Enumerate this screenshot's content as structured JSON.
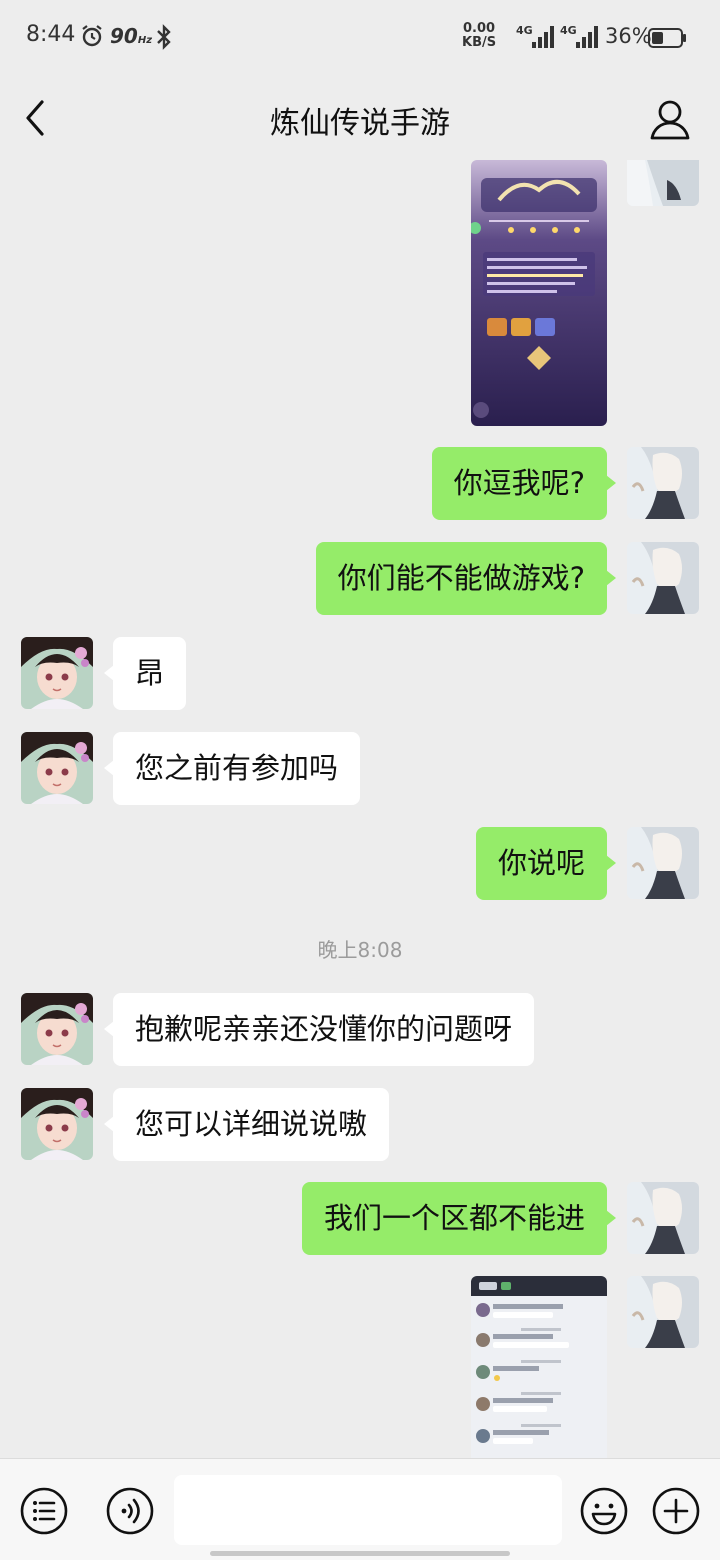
{
  "status_bar": {
    "time": "8:44",
    "refresh": "90",
    "refresh_unit": "Hz",
    "speed_value": "0.00",
    "speed_unit": "KB/S",
    "net1": "4G",
    "net2": "4G",
    "battery": "36%"
  },
  "header": {
    "title": "炼仙传说手游"
  },
  "messages": [
    {
      "from": "me",
      "type": "image"
    },
    {
      "from": "me",
      "type": "text",
      "text": "你逗我呢?"
    },
    {
      "from": "me",
      "type": "text",
      "text": "你们能不能做游戏?"
    },
    {
      "from": "them",
      "type": "text",
      "text": "昂"
    },
    {
      "from": "them",
      "type": "text",
      "text": "您之前有参加吗"
    },
    {
      "from": "me",
      "type": "text",
      "text": "你说呢"
    },
    {
      "from": "them",
      "type": "text",
      "text": "抱歉呢亲亲还没懂你的问题呀"
    },
    {
      "from": "them",
      "type": "text",
      "text": "您可以详细说说嗷"
    },
    {
      "from": "me",
      "type": "text",
      "text": "我们一个区都不能进"
    },
    {
      "from": "me",
      "type": "image"
    }
  ],
  "timestamp": "晚上8:08",
  "input": {
    "placeholder": ""
  },
  "colors": {
    "background": "#ededed",
    "my_bubble": "#95ec69",
    "their_bubble": "#ffffff"
  },
  "icons": [
    "back-arrow-icon",
    "user-profile-icon",
    "menu-list-icon",
    "voice-icon",
    "emoji-icon",
    "plus-icon"
  ]
}
